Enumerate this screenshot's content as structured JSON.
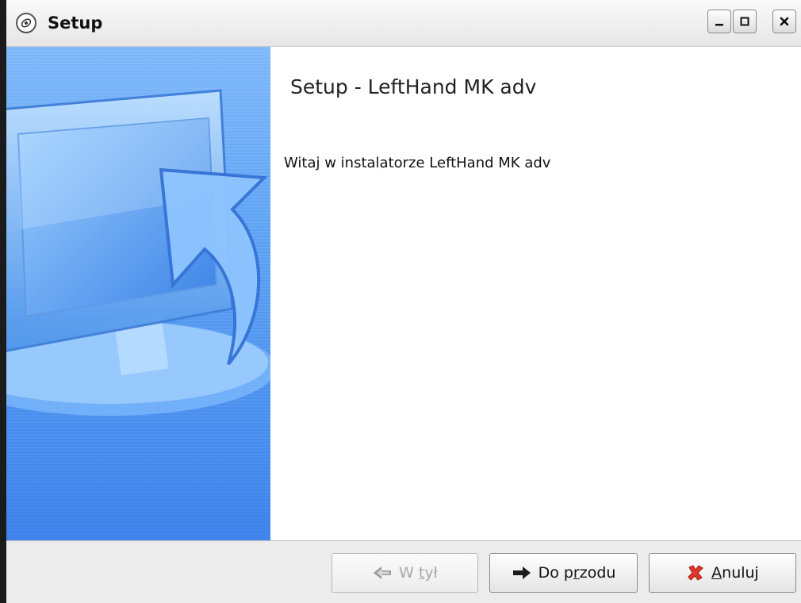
{
  "window": {
    "title": "Setup",
    "icon": "setup-app-icon",
    "controls": [
      "minimize-icon",
      "maximize-icon",
      "close-icon"
    ]
  },
  "content": {
    "heading": "Setup - LeftHand MK adv",
    "welcome": "Witaj w instalatorze LeftHand MK adv"
  },
  "sidebar": {
    "image": "monitor-with-arrow-illustration",
    "colors": {
      "top": "#8ec4ff",
      "bottom": "#2f86ee"
    }
  },
  "buttons": {
    "back": {
      "label_pre": "W ",
      "mnemonic": "t",
      "label_post": "ył",
      "enabled": false,
      "icon": "arrow-left-icon"
    },
    "next": {
      "label_pre": "Do p",
      "mnemonic": "r",
      "label_post": "zodu",
      "enabled": true,
      "icon": "arrow-right-icon"
    },
    "cancel": {
      "label_pre": "",
      "mnemonic": "A",
      "label_post": "nuluj",
      "enabled": true,
      "icon": "red-x-icon"
    }
  }
}
